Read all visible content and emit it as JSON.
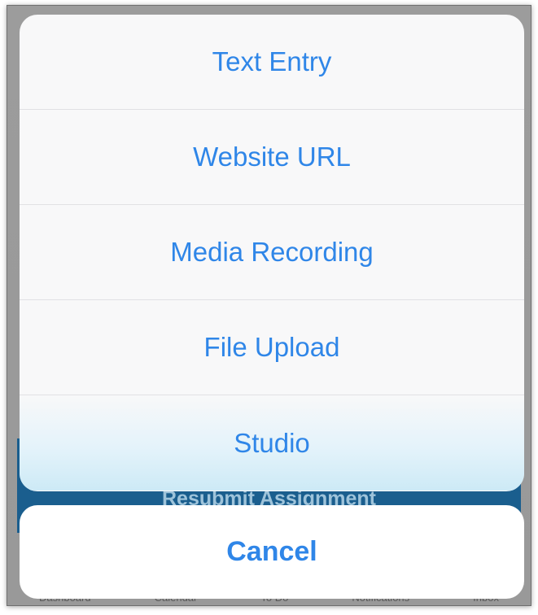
{
  "background": {
    "button_label": "Resubmit Assignment",
    "tab_items": [
      "Dashboard",
      "Calendar",
      "To Do",
      "Notifications",
      "Inbox"
    ]
  },
  "action_sheet": {
    "items": [
      {
        "label": "Text Entry"
      },
      {
        "label": "Website URL"
      },
      {
        "label": "Media Recording"
      },
      {
        "label": "File Upload"
      },
      {
        "label": "Studio"
      }
    ],
    "cancel_label": "Cancel"
  },
  "colors": {
    "accent": "#2f86e8",
    "background_button": "#1a5e8e"
  }
}
